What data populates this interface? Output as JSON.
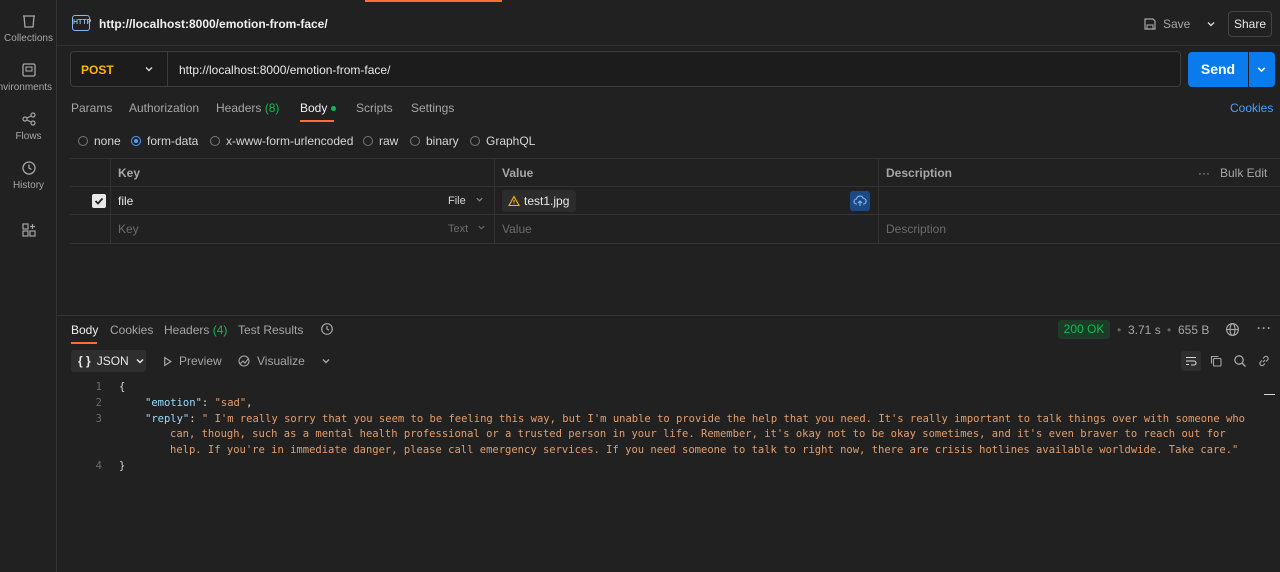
{
  "sidebar": {
    "items": [
      {
        "label": "Collections",
        "icon": "collections-icon"
      },
      {
        "label": "Environments",
        "icon": "environments-icon"
      },
      {
        "label": "Flows",
        "icon": "flows-icon"
      },
      {
        "label": "History",
        "icon": "history-icon"
      },
      {
        "label": "",
        "icon": "add-workbench-icon"
      }
    ]
  },
  "topbar": {
    "icon_text": "HTTP",
    "title": "http://localhost:8000/emotion-from-face/",
    "save_label": "Save",
    "share_label": "Share"
  },
  "request": {
    "method": "POST",
    "url": "http://localhost:8000/emotion-from-face/",
    "send_label": "Send",
    "tabs": [
      "Params",
      "Authorization",
      "Headers",
      "(8)",
      "Body",
      "Scripts",
      "Settings"
    ],
    "cookies_label": "Cookies",
    "body_types": [
      "none",
      "form-data",
      "x-www-form-urlencoded",
      "raw",
      "binary",
      "GraphQL"
    ],
    "selected_body_type": "form-data"
  },
  "params_table": {
    "headers": {
      "key": "Key",
      "value": "Value",
      "description": "Description",
      "bulk_edit": "Bulk Edit"
    },
    "rows": [
      {
        "key": "file",
        "type": "File",
        "value": "test1.jpg",
        "checked": true
      }
    ],
    "placeholder": {
      "key": "Key",
      "type": "Text",
      "value": "Value",
      "description": "Description"
    }
  },
  "response": {
    "tabs": [
      "Body",
      "Cookies",
      "Headers",
      "(4)",
      "Test Results"
    ],
    "status": "200 OK",
    "time": "3.71 s",
    "size": "655 B",
    "format": "JSON",
    "preview_label": "Preview",
    "visualize_label": "Visualize",
    "code": {
      "line_numbers": [
        "1",
        "2",
        "3",
        "4"
      ],
      "open": "{",
      "emotion_key": "\"emotion\"",
      "emotion_value": "\"sad\"",
      "reply_key": "\"reply\"",
      "reply_line1": "\" I'm really sorry that you seem to be feeling this way, but I'm unable to provide the help that you need. It's really important to talk things over with someone who",
      "reply_line2": "can, though, such as a mental health professional or a trusted person in your life. Remember, it's okay not to be okay sometimes, and it's even braver to reach out for",
      "reply_line3": "help. If you're in immediate danger, please call emergency services. If you need someone to talk to right now, there are crisis hotlines available worldwide. Take care.\"",
      "close": "}"
    }
  },
  "colors": {
    "accent": "#ff6c37",
    "send": "#097bed",
    "method": "#ffb400",
    "ok": "#0cbb52"
  }
}
